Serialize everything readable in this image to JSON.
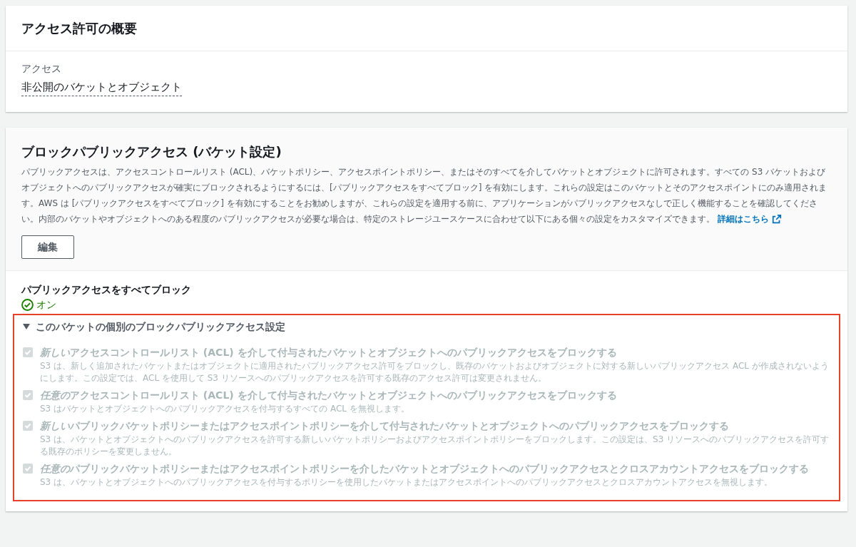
{
  "overview": {
    "title": "アクセス許可の概要",
    "label": "アクセス",
    "value": "非公開のバケットとオブジェクト"
  },
  "block_public_access": {
    "title": "ブロックパブリックアクセス (バケット設定)",
    "description": "パブリックアクセスは、アクセスコントロールリスト (ACL)、バケットポリシー、アクセスポイントポリシー、またはそのすべてを介してバケットとオブジェクトに許可されます。すべての S3 バケットおよびオブジェクトへのパブリックアクセスが確実にブロックされるようにするには、[パブリックアクセスをすべてブロック] を有効にします。これらの設定はこのバケットとそのアクセスポイントにのみ適用されます。AWS は [パブリックアクセスをすべてブロック] を有効にすることをお勧めしますが、これらの設定を適用する前に、アプリケーションがパブリックアクセスなしで正しく機能することを確認してください。内部のバケットやオブジェクトへのある程度のパブリックアクセスが必要な場合は、特定のストレージユースケースに合わせて以下にある個々の設定をカスタマイズできます。",
    "link": "詳細はこちら",
    "edit_button": "編集",
    "block_all": {
      "label": "パブリックアクセスをすべてブロック",
      "status": "オン",
      "on": true
    },
    "individual": {
      "title": "このバケットの個別のブロックパブリックアクセス設定",
      "expanded": true,
      "highlighted": true,
      "settings": [
        {
          "emphasis": "新しい",
          "label": "アクセスコントロールリスト (ACL) を介して付与されたバケットとオブジェクトへのパブリックアクセスをブロックする",
          "description": "S3 は、新しく追加されたバケットまたはオブジェクトに適用されたパブリックアクセス許可をブロックし、既存のバケットおよびオブジェクトに対する新しいパブリックアクセス ACL が作成されないようにします。この設定では、ACL を使用して S3 リソースへのパブリックアクセスを許可する既存のアクセス許可は変更されません。",
          "checked": true,
          "disabled": true
        },
        {
          "emphasis": "任意の",
          "label": "アクセスコントロールリスト (ACL) を介して付与されたバケットとオブジェクトへのパブリックアクセスをブロックする",
          "description": "S3 はバケットとオブジェクトへのパブリックアクセスを付与するすべての ACL を無視します。",
          "checked": true,
          "disabled": true
        },
        {
          "emphasis": "新しい",
          "label": "パブリックバケットポリシーまたはアクセスポイントポリシーを介して付与されたバケットとオブジェクトへのパブリックアクセスをブロックする",
          "description": "S3 は、バケットとオブジェクトへのパブリックアクセスを許可する新しいバケットポリシーおよびアクセスポイントポリシーをブロックします。この設定は、S3 リソースへのパブリックアクセスを許可する既存のポリシーを変更しません。",
          "checked": true,
          "disabled": true
        },
        {
          "emphasis": "任意の",
          "label": "パブリックバケットポリシーまたはアクセスポイントポリシーを介したバケットとオブジェクトへのパブリックアクセスとクロスアカウントアクセスをブロックする",
          "description": "S3 は、バケットとオブジェクトへのパブリックアクセスを付与するポリシーを使用したバケットまたはアクセスポイントへのパブリックアクセスとクロスアカウントアクセスを無視します。",
          "checked": true,
          "disabled": true
        }
      ]
    }
  }
}
